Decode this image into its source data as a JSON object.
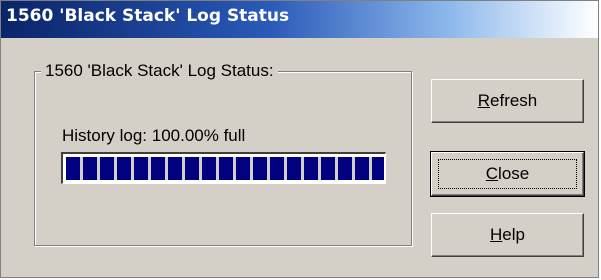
{
  "window": {
    "title": "1560 'Black Stack' Log Status"
  },
  "group": {
    "legend": "1560 'Black Stack' Log Status:"
  },
  "history": {
    "label": "History log: 100.00% full",
    "progress_fraction": 1.0
  },
  "buttons": {
    "refresh": {
      "mnemonic": "R",
      "rest": "efresh"
    },
    "close": {
      "mnemonic": "C",
      "rest": "lose"
    },
    "help": {
      "mnemonic": "H",
      "rest": "elp"
    }
  },
  "colors": {
    "progress_block": "#000080",
    "titlebar_start": "#0a246a",
    "face": "#d4d0c8"
  }
}
